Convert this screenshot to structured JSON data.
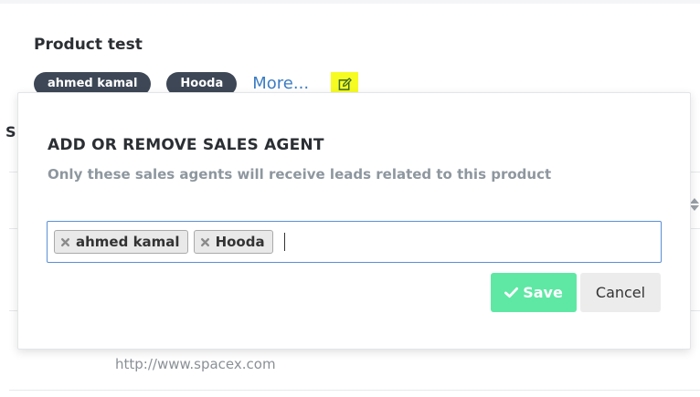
{
  "product": {
    "title": "Product test",
    "agents": [
      "ahmed kamal",
      "Hooda"
    ],
    "more_label": "More..."
  },
  "background": {
    "cut_heading": "S",
    "url": "http://www.spacex.com"
  },
  "popover": {
    "title": "ADD OR REMOVE SALES AGENT",
    "subtitle": "Only these sales agents will receive leads related to this product",
    "selected_agents": [
      "ahmed kamal",
      "Hooda"
    ],
    "input_value": "",
    "save_label": "Save",
    "cancel_label": "Cancel"
  },
  "colors": {
    "pill_bg": "#3e4756",
    "link": "#3d7dc3",
    "highlight": "#f6fb22",
    "save_bg": "#5ee8a4",
    "input_border": "#5b8fd6"
  },
  "icons": {
    "edit": "edit-icon",
    "remove": "close-icon",
    "save": "check-icon",
    "sort": "sort-icon"
  }
}
